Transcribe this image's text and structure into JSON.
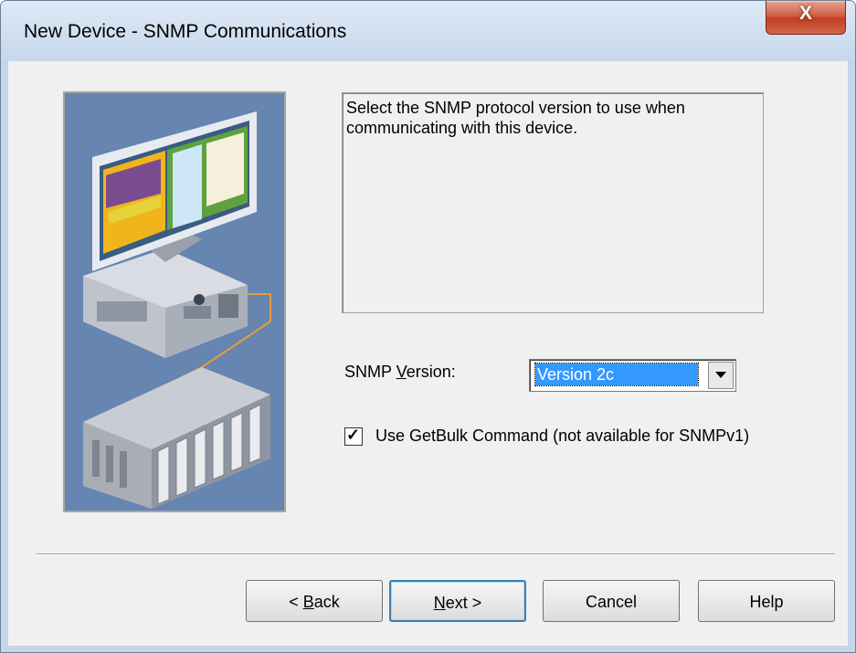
{
  "window": {
    "title": "New Device - SNMP Communications",
    "close_glyph": "X"
  },
  "description": "Select the SNMP protocol version to use when communicating with this device.",
  "snmp": {
    "label_prefix": "SNMP ",
    "label_mnemonic": "V",
    "label_suffix": "ersion:",
    "selected": "Version 2c"
  },
  "getbulk": {
    "checked": true,
    "check_glyph": "✓",
    "label": "Use GetBulk Command (not available for SNMPv1)"
  },
  "buttons": {
    "back_prefix": "< ",
    "back_mnemonic": "B",
    "back_suffix": "ack",
    "next_mnemonic": "N",
    "next_suffix": "ext >",
    "cancel": "Cancel",
    "help": "Help"
  },
  "illustration": {
    "name": "computer-plc-illustration"
  }
}
